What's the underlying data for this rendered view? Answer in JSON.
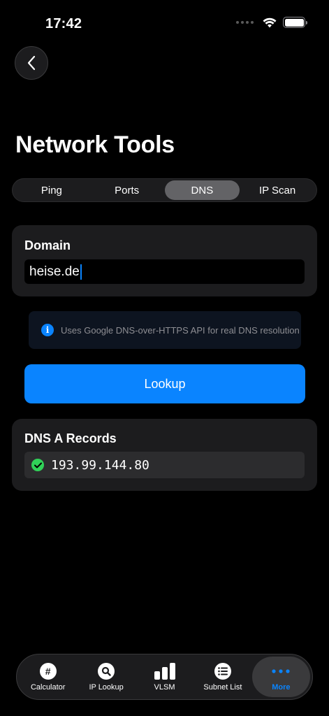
{
  "status_bar": {
    "time": "17:42"
  },
  "header": {
    "title": "Network Tools"
  },
  "segments": [
    {
      "label": "Ping",
      "active": false
    },
    {
      "label": "Ports",
      "active": false
    },
    {
      "label": "DNS",
      "active": true
    },
    {
      "label": "IP Scan",
      "active": false
    }
  ],
  "domain_card": {
    "label": "Domain",
    "value": "heise.de"
  },
  "info": {
    "text": "Uses Google DNS-over-HTTPS API for real DNS resolution"
  },
  "lookup_button": {
    "label": "Lookup"
  },
  "records_card": {
    "title": "DNS A Records",
    "records": [
      "193.99.144.80"
    ]
  },
  "tab_bar": {
    "tabs": [
      {
        "label": "Calculator",
        "icon": "hash-icon",
        "active": false
      },
      {
        "label": "IP Lookup",
        "icon": "magnifier-icon",
        "active": false
      },
      {
        "label": "VLSM",
        "icon": "bars-icon",
        "active": false
      },
      {
        "label": "Subnet List",
        "icon": "list-icon",
        "active": false
      },
      {
        "label": "More",
        "icon": "ellipsis-icon",
        "active": true
      }
    ]
  },
  "colors": {
    "accent": "#0a84ff",
    "success": "#30d158",
    "card": "#1c1c1e"
  }
}
